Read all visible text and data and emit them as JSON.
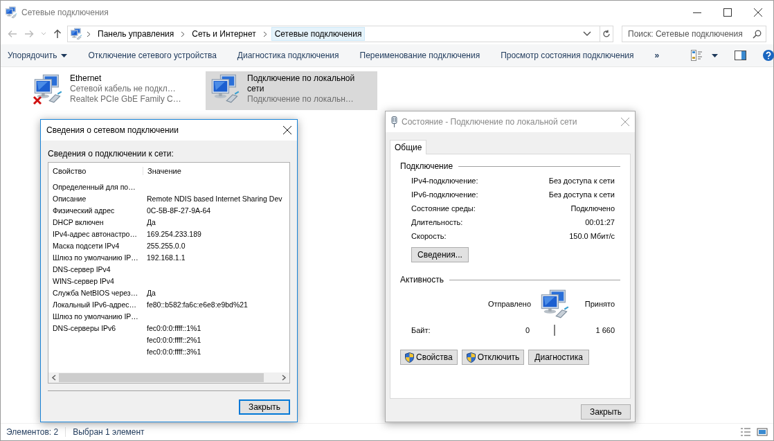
{
  "window": {
    "title": "Сетевые подключения"
  },
  "address_bar": {
    "breadcrumbs": [
      {
        "label": "Панель управления",
        "selected": false
      },
      {
        "label": "Сеть и Интернет",
        "selected": false
      },
      {
        "label": "Сетевые подключения",
        "selected": true
      }
    ]
  },
  "search": {
    "placeholder": "Поиск: Сетевые подключения"
  },
  "toolbar": {
    "commands": [
      {
        "label": "Упорядочить",
        "kind": "menu"
      },
      {
        "label": "Отключение сетевого устройства",
        "kind": "command"
      },
      {
        "label": "Диагностика подключения",
        "kind": "command"
      },
      {
        "label": "Переименование подключения",
        "kind": "command"
      },
      {
        "label": "Просмотр состояния подключения",
        "kind": "command"
      }
    ],
    "overflow": "»"
  },
  "connections": [
    {
      "name": "Ethernet",
      "status": "Сетевой кабель не подкл…",
      "device": "Realtek PCIe GbE Family C…",
      "disconnected": true,
      "selected": false
    },
    {
      "name": "Подключение по локальной сети",
      "status": "Подключение по локальн…",
      "disconnected": false,
      "selected": true
    }
  ],
  "details_dialog": {
    "title": "Сведения о сетевом подключении",
    "active": true,
    "caption": "Сведения о подключении к сети:",
    "columns": [
      "Свойство",
      "Значение"
    ],
    "rows": [
      {
        "property": "Определенный для по…"
      },
      {
        "property": "Описание",
        "value": "Remote NDIS based Internet Sharing Dev"
      },
      {
        "property": "Физический адрес",
        "value": "0C-5B-8F-27-9A-64"
      },
      {
        "property": "DHCP включен",
        "value": "Да"
      },
      {
        "property": "IPv4-адрес автонастро…",
        "value": "169.254.233.189"
      },
      {
        "property": "Маска подсети IPv4",
        "value": "255.255.0.0"
      },
      {
        "property": "Шлюз по умолчанию IP…",
        "value": "192.168.1.1"
      },
      {
        "property": "DNS-сервер IPv4"
      },
      {
        "property": "WINS-сервер IPv4"
      },
      {
        "property": "Служба NetBIOS через…",
        "value": "Да"
      },
      {
        "property": "Локальный IPv6-адрес…",
        "value": "fe80::b582:fa6c:e6e8:e9bd%21"
      },
      {
        "property": "Шлюз по умолчанию IP…"
      },
      {
        "property": "DNS-серверы IPv6",
        "value": "fec0:0:0:ffff::1%1"
      },
      {
        "value": "fec0:0:0:ffff::2%1"
      },
      {
        "value": "fec0:0:0:ffff::3%1"
      }
    ],
    "close_button": "Закрыть"
  },
  "status_dialog": {
    "title": "Состояние - Подключение по локальной сети",
    "active": false,
    "tabs": [
      {
        "label": "Общие",
        "selected": true
      }
    ],
    "connection_section": "Подключение",
    "connection_rows": [
      {
        "label": "IPv4-подключение:",
        "value": "Без доступа к сети"
      },
      {
        "label": "IPv6-подключение:",
        "value": "Без доступа к сети"
      },
      {
        "label": "Состояние среды:",
        "value": "Подключено"
      },
      {
        "label": "Длительность:",
        "value": "00:01:27"
      },
      {
        "label": "Скорость:",
        "value": "150.0 Мбит/с"
      }
    ],
    "details_button": "Сведения...",
    "activity_section": "Активность",
    "sent_label": "Отправлено",
    "received_label": "Принято",
    "bytes_label": "Байт:",
    "bytes_sent": "0",
    "bytes_received": "1 660",
    "buttons": [
      {
        "label": "Свойства",
        "kind": "shield"
      },
      {
        "label": "Отключить",
        "kind": "shield"
      },
      {
        "label": "Диагностика",
        "kind": "plain"
      }
    ],
    "close_button": "Закрыть"
  },
  "status_bar": {
    "item_count": "Элементов: 2",
    "selection": "Выбран 1 элемент"
  }
}
